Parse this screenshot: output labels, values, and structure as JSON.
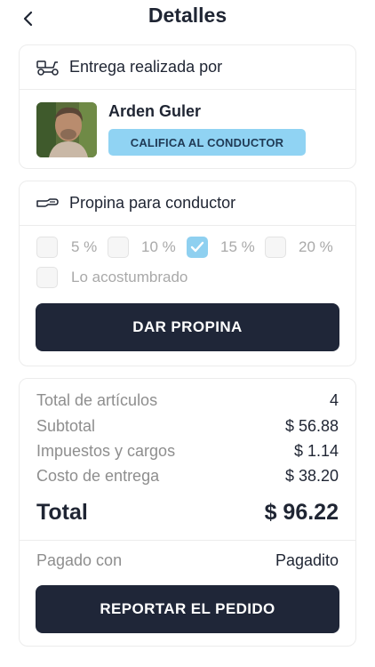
{
  "header": {
    "title": "Detalles"
  },
  "driver": {
    "section_title": "Entrega realizada por",
    "name": "Arden Guler",
    "rate_label": "CALIFICA AL CONDUCTOR"
  },
  "tip": {
    "section_title": "Propina para conductor",
    "options": [
      {
        "label": "5 %",
        "checked": false
      },
      {
        "label": "10 %",
        "checked": false
      },
      {
        "label": "15 %",
        "checked": true
      },
      {
        "label": "20 %",
        "checked": false
      }
    ],
    "custom_label": "Lo acostumbrado",
    "button_label": "DAR PROPINA"
  },
  "summary": {
    "items_label": "Total de artículos",
    "items_value": "4",
    "subtotal_label": "Subtotal",
    "subtotal_value": "$ 56.88",
    "taxes_label": "Impuestos y cargos",
    "taxes_value": "$ 1.14",
    "delivery_label": "Costo de entrega",
    "delivery_value": "$ 38.20",
    "total_label": "Total",
    "total_value": "$ 96.22",
    "paid_label": "Pagado con",
    "paid_value": "Pagadito",
    "report_label": "REPORTAR EL PEDIDO"
  },
  "colors": {
    "primary_button": "#1f2638",
    "accent": "#90d3f3",
    "text_dark": "#1f2533",
    "text_muted": "#8e8e8e"
  }
}
